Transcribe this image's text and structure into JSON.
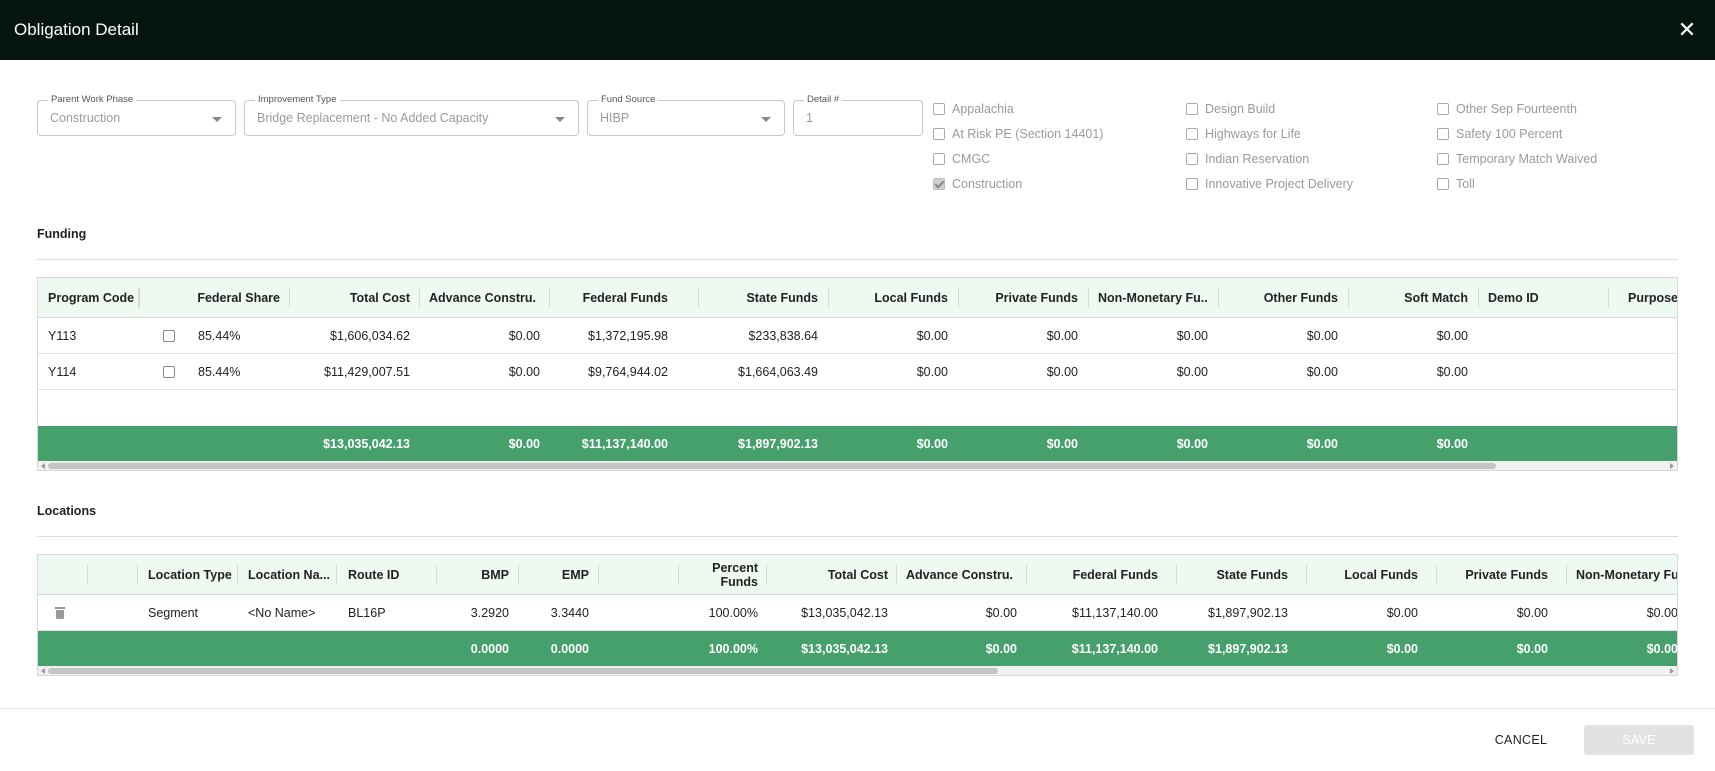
{
  "header": {
    "title": "Obligation Detail",
    "close_icon": "close-icon"
  },
  "form": {
    "parent_work_phase": {
      "label": "Parent Work Phase",
      "value": "Construction"
    },
    "improvement_type": {
      "label": "Improvement Type",
      "value": "Bridge Replacement - No Added Capacity"
    },
    "fund_source": {
      "label": "Fund Source",
      "value": "HIBP"
    },
    "detail_number": {
      "label": "Detail #",
      "value": "1"
    }
  },
  "checkboxes": [
    {
      "label": "Appalachia",
      "checked": false
    },
    {
      "label": "At Risk PE (Section 14401)",
      "checked": false
    },
    {
      "label": "CMGC",
      "checked": false
    },
    {
      "label": "Construction",
      "checked": true
    },
    {
      "label": "Design Build",
      "checked": false
    },
    {
      "label": "Highways for Life",
      "checked": false
    },
    {
      "label": "Indian Reservation",
      "checked": false
    },
    {
      "label": "Innovative Project Delivery",
      "checked": false
    },
    {
      "label": "Other Sep Fourteenth",
      "checked": false
    },
    {
      "label": "Safety 100 Percent",
      "checked": false
    },
    {
      "label": "Temporary Match Waived",
      "checked": false
    },
    {
      "label": "Toll",
      "checked": false
    }
  ],
  "funding": {
    "title": "Funding",
    "columns": [
      "Program Code",
      "",
      "Federal Share",
      "Total Cost",
      "Advance Constru...",
      "Federal Funds",
      "State Funds",
      "Local Funds",
      "Private Funds",
      "Non-Monetary Fu...",
      "Other Funds",
      "Soft Match",
      "Demo ID",
      "Purpose ID"
    ],
    "rows": [
      {
        "program_code": "Y113",
        "checked": false,
        "federal_share": "85.44%",
        "total_cost": "$1,606,034.62",
        "advance": "$0.00",
        "federal": "$1,372,195.98",
        "state": "$233,838.64",
        "local": "$0.00",
        "private": "$0.00",
        "nonmonetary": "$0.00",
        "other": "$0.00",
        "soft_match": "$0.00"
      },
      {
        "program_code": "Y114",
        "checked": false,
        "federal_share": "85.44%",
        "total_cost": "$11,429,007.51",
        "advance": "$0.00",
        "federal": "$9,764,944.02",
        "state": "$1,664,063.49",
        "local": "$0.00",
        "private": "$0.00",
        "nonmonetary": "$0.00",
        "other": "$0.00",
        "soft_match": "$0.00"
      }
    ],
    "totals": {
      "total_cost": "$13,035,042.13",
      "advance": "$0.00",
      "federal": "$11,137,140.00",
      "state": "$1,897,902.13",
      "local": "$0.00",
      "private": "$0.00",
      "nonmonetary": "$0.00",
      "other": "$0.00",
      "soft_match": "$0.00"
    }
  },
  "locations": {
    "title": "Locations",
    "columns": [
      "",
      "",
      "Location Type",
      "Location Na...",
      "Route ID",
      "BMP",
      "EMP",
      "",
      "Percent Funds",
      "Total Cost",
      "Advance Constru...",
      "Federal Funds",
      "State Funds",
      "Local Funds",
      "Private Funds",
      "Non-Monetary Fu..."
    ],
    "percent_funds_line1": "Percent",
    "percent_funds_line2": "Funds",
    "rows": [
      {
        "location_type": "Segment",
        "location_name": "<No Name>",
        "route_id": "BL16P",
        "bmp": "3.2920",
        "emp": "3.3440",
        "percent": "100.00%",
        "total_cost": "$13,035,042.13",
        "advance": "$0.00",
        "federal": "$11,137,140.00",
        "state": "$1,897,902.13",
        "local": "$0.00",
        "private": "$0.00",
        "nonmonetary": "$0.00"
      }
    ],
    "totals": {
      "bmp": "0.0000",
      "emp": "0.0000",
      "percent": "100.00%",
      "total_cost": "$13,035,042.13",
      "advance": "$0.00",
      "federal": "$11,137,140.00",
      "state": "$1,897,902.13",
      "local": "$0.00",
      "private": "$0.00",
      "nonmonetary": "$0.00"
    }
  },
  "footer": {
    "cancel_label": "CANCEL",
    "save_label": "SAVE"
  },
  "colors": {
    "header_bg": "#061412",
    "total_row_bg": "#46a06b",
    "grid_header_bg": "#eefaf1"
  }
}
